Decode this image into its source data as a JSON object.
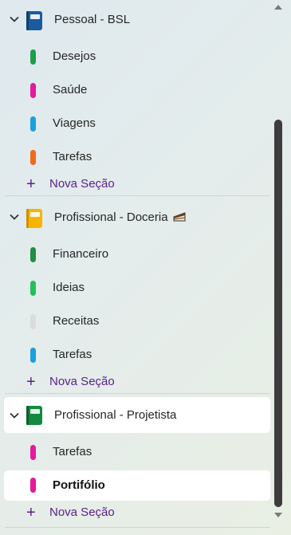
{
  "colors": {
    "accent": "#5b1e8a",
    "notebook_blue": "#1a5c9e",
    "notebook_yellow": "#f7b500",
    "notebook_green": "#138a3e"
  },
  "notebooks": [
    {
      "name": "Pessoal - BSL",
      "icon": "notebook-icon",
      "icon_color": "#1a5c9e",
      "expanded": true,
      "sections": [
        {
          "label": "Desejos",
          "color": "#1e9e4a"
        },
        {
          "label": "Saúde",
          "color": "#e5199c"
        },
        {
          "label": "Viagens",
          "color": "#1aa0dc"
        },
        {
          "label": "Tarefas",
          "color": "#ee6b1c"
        }
      ],
      "add_label": "Nova Seção"
    },
    {
      "name": "Profissional - Doceria",
      "emoji_icon": "cake-icon",
      "icon": "notebook-icon",
      "icon_color": "#f7b500",
      "expanded": true,
      "sections": [
        {
          "label": "Financeiro",
          "color": "#1e8f45"
        },
        {
          "label": "Ideias",
          "color": "#22c05a"
        },
        {
          "label": "Receitas",
          "color": "#dcdcdc"
        },
        {
          "label": "Tarefas",
          "color": "#1aa0dc"
        }
      ],
      "add_label": "Nova Seção"
    },
    {
      "name": "Profissional - Projetista",
      "icon": "notebook-icon",
      "icon_color": "#138a3e",
      "expanded": true,
      "selected": true,
      "sections": [
        {
          "label": "Tarefas",
          "color": "#e5199c"
        },
        {
          "label": "Portifólio",
          "color": "#e5199c",
          "selected": true
        }
      ],
      "add_label": "Nova Seção"
    }
  ]
}
